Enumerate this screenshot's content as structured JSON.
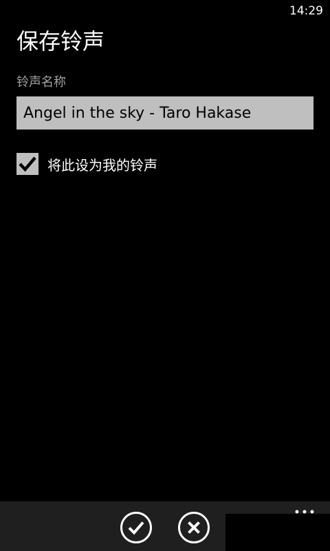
{
  "status_bar": {
    "time": "14:29"
  },
  "page": {
    "title": "保存铃声"
  },
  "ringtone_name": {
    "label": "铃声名称",
    "value": "Angel in the sky - Taro Hakase"
  },
  "set_as_ringtone": {
    "label": "将此设为我的铃声",
    "checked": true
  },
  "app_bar": {
    "buttons": [
      "check-icon",
      "close-icon"
    ],
    "more_icon": "ellipsis-icon",
    "background": "#1f1f1f"
  },
  "colors": {
    "background": "#000000",
    "input_background": "#bfbfbf",
    "label_gray": "#a0a0a0"
  }
}
